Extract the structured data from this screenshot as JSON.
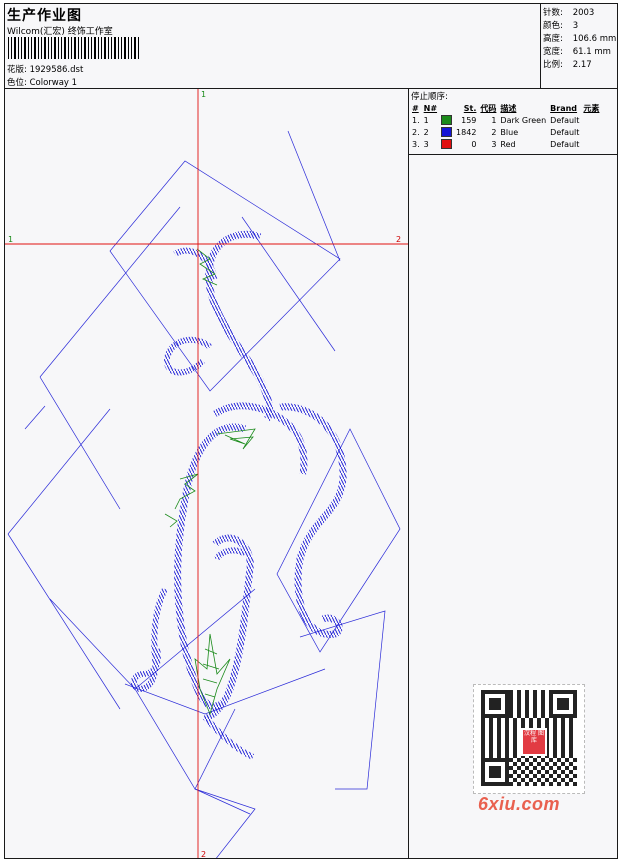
{
  "header": {
    "title": "生产作业图",
    "company": "Wilcom(汇宏) 终饰工作室",
    "design_label": "花版:",
    "design_file": "1929586.dst",
    "colorway_label": "色位:",
    "colorway_name": "Colorway 1"
  },
  "stats": [
    {
      "label": "针数:",
      "value": "2003"
    },
    {
      "label": "颜色:",
      "value": "3"
    },
    {
      "label": "高度:",
      "value": "106.6 mm"
    },
    {
      "label": "宽度:",
      "value": "61.1 mm"
    },
    {
      "label": "比例:",
      "value": "2.17"
    }
  ],
  "guides": {
    "vertical_top": "1",
    "vertical_bottom": "2",
    "horizontal_left": "1",
    "horizontal_right": "2"
  },
  "stop_sequence": {
    "title": "停止顺序:",
    "columns": [
      "#",
      "N#",
      "",
      "St.",
      "代码",
      "描述",
      "Brand",
      "元素"
    ],
    "rows": [
      {
        "index": "1.",
        "needle": "1",
        "color": "#1a8a1a",
        "stitches": "159",
        "code": "1",
        "description": "Dark Green",
        "brand": "Default"
      },
      {
        "index": "2.",
        "needle": "2",
        "color": "#1414d6",
        "stitches": "1842",
        "code": "2",
        "description": "Blue",
        "brand": "Default"
      },
      {
        "index": "3.",
        "needle": "3",
        "color": "#e01010",
        "stitches": "0",
        "code": "3",
        "description": "Red",
        "brand": "Default"
      }
    ]
  },
  "watermark": {
    "badge_text": "汉程 图库",
    "site": "6xiu.com"
  },
  "colors": {
    "guide_line": "#e01010",
    "stitch_blue": "#1414d6",
    "stitch_green": "#1a8a1a"
  }
}
